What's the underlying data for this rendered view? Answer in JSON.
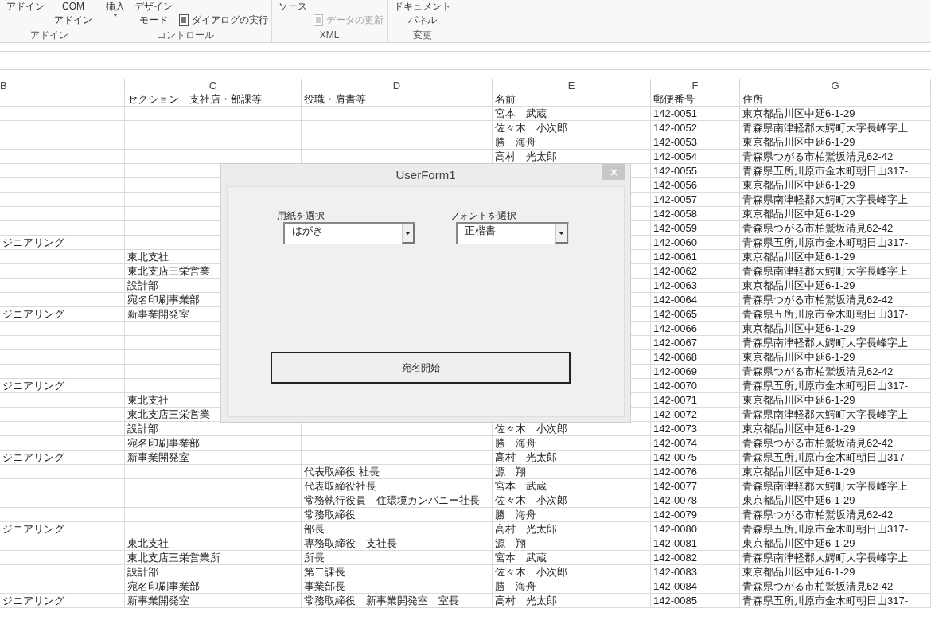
{
  "ribbon": {
    "groups": [
      {
        "label": "アドイン",
        "buttons": [
          {
            "lines": [
              "アドイン"
            ],
            "kind": "large",
            "disabled": false
          },
          {
            "lines": [
              "COM",
              "アドイン"
            ],
            "kind": "large",
            "disabled": false
          }
        ]
      },
      {
        "label": "コントロール",
        "buttons": [
          {
            "label": "挿入",
            "kind": "dropdown",
            "disabled": false
          },
          {
            "lines": [
              "デザイン",
              "モード"
            ],
            "kind": "large",
            "disabled": false
          },
          {
            "label": "ダイアログの実行",
            "kind": "small",
            "disabled": false
          }
        ]
      },
      {
        "label": "XML",
        "buttons": [
          {
            "lines": [
              "ソース"
            ],
            "kind": "large",
            "disabled": false
          },
          {
            "label": "データの更新",
            "kind": "small",
            "disabled": true
          }
        ]
      },
      {
        "label": "変更",
        "buttons": [
          {
            "lines": [
              "ドキュメント",
              "パネル"
            ],
            "kind": "large",
            "disabled": false
          }
        ]
      }
    ]
  },
  "sheet": {
    "columns": [
      "B",
      "C",
      "D",
      "E",
      "F",
      "G"
    ],
    "rows": [
      {
        "c": "セクション　支社店・部課等",
        "d": "役職・肩書等",
        "e": "名前",
        "f": "郵便番号",
        "g": "住所"
      },
      {
        "e": "宮本　武蔵",
        "f": "142-0051",
        "g": "東京都品川区中延6-1-29"
      },
      {
        "e": "佐々木　小次郎",
        "f": "142-0052",
        "g": "青森県南津軽郡大鰐町大字長峰字上"
      },
      {
        "e": "勝　海舟",
        "f": "142-0053",
        "g": "東京都品川区中延6-1-29"
      },
      {
        "e": "高村　光太郎",
        "f": "142-0054",
        "g": "青森県つがる市柏鷲坂清見62-42"
      },
      {
        "f": "142-0055",
        "g": "青森県五所川原市金木町朝日山317-"
      },
      {
        "f": "142-0056",
        "g": "東京都品川区中延6-1-29"
      },
      {
        "f": "142-0057",
        "g": "青森県南津軽郡大鰐町大字長峰字上"
      },
      {
        "f": "142-0058",
        "g": "東京都品川区中延6-1-29"
      },
      {
        "f": "142-0059",
        "g": "青森県つがる市柏鷲坂清見62-42"
      },
      {
        "b": "ジニアリング",
        "f": "142-0060",
        "g": "青森県五所川原市金木町朝日山317-"
      },
      {
        "c": "東北支社",
        "f": "142-0061",
        "g": "東京都品川区中延6-1-29"
      },
      {
        "c": "東北支店三栄営業",
        "f": "142-0062",
        "g": "青森県南津軽郡大鰐町大字長峰字上"
      },
      {
        "c": "設計部",
        "f": "142-0063",
        "g": "東京都品川区中延6-1-29"
      },
      {
        "c": "宛名印刷事業部",
        "f": "142-0064",
        "g": "青森県つがる市柏鷲坂清見62-42"
      },
      {
        "b": "ジニアリング",
        "c": "新事業開発室",
        "f": "142-0065",
        "g": "青森県五所川原市金木町朝日山317-"
      },
      {
        "f": "142-0066",
        "g": "東京都品川区中延6-1-29"
      },
      {
        "f": "142-0067",
        "g": "青森県南津軽郡大鰐町大字長峰字上"
      },
      {
        "f": "142-0068",
        "g": "東京都品川区中延6-1-29"
      },
      {
        "f": "142-0069",
        "g": "青森県つがる市柏鷲坂清見62-42"
      },
      {
        "b": "ジニアリング",
        "f": "142-0070",
        "g": "青森県五所川原市金木町朝日山317-"
      },
      {
        "c": "東北支社",
        "f": "142-0071",
        "g": "東京都品川区中延6-1-29"
      },
      {
        "c": "東北支店三栄営業",
        "f": "142-0072",
        "g": "青森県南津軽郡大鰐町大字長峰字上"
      },
      {
        "c": "設計部",
        "e": "佐々木　小次郎",
        "f": "142-0073",
        "g": "東京都品川区中延6-1-29"
      },
      {
        "c": "宛名印刷事業部",
        "e": "勝　海舟",
        "f": "142-0074",
        "g": "青森県つがる市柏鷲坂清見62-42"
      },
      {
        "b": "ジニアリング",
        "c": "新事業開発室",
        "e": "高村　光太郎",
        "f": "142-0075",
        "g": "青森県五所川原市金木町朝日山317-"
      },
      {
        "d": "代表取締役 社長",
        "e": "源　翔",
        "f": "142-0076",
        "g": "東京都品川区中延6-1-29"
      },
      {
        "d": "代表取締役社長",
        "e": "宮本　武蔵",
        "f": "142-0077",
        "g": "青森県南津軽郡大鰐町大字長峰字上"
      },
      {
        "d": "常務執行役員　住環境カンパニー社長",
        "e": "佐々木　小次郎",
        "f": "142-0078",
        "g": "東京都品川区中延6-1-29"
      },
      {
        "d": "常務取締役",
        "e": "勝　海舟",
        "f": "142-0079",
        "g": "青森県つがる市柏鷲坂清見62-42"
      },
      {
        "b": "ジニアリング",
        "d": "部長",
        "e": "高村　光太郎",
        "f": "142-0080",
        "g": "青森県五所川原市金木町朝日山317-"
      },
      {
        "c": "東北支社",
        "d": "専務取締役　支社長",
        "e": "源　翔",
        "f": "142-0081",
        "g": "東京都品川区中延6-1-29"
      },
      {
        "c": "東北支店三栄営業所",
        "d": "所長",
        "e": "宮本　武蔵",
        "f": "142-0082",
        "g": "青森県南津軽郡大鰐町大字長峰字上"
      },
      {
        "c": "設計部",
        "d": "第二課長",
        "e": "佐々木　小次郎",
        "f": "142-0083",
        "g": "東京都品川区中延6-1-29"
      },
      {
        "c": "宛名印刷事業部",
        "d": "事業部長",
        "e": "勝　海舟",
        "f": "142-0084",
        "g": "青森県つがる市柏鷲坂清見62-42"
      },
      {
        "b": "ジニアリング",
        "c": "新事業開発室",
        "d": "常務取締役　新事業開発室　室長",
        "e": "高村　光太郎",
        "f": "142-0085",
        "g": "青森県五所川原市金木町朝日山317-"
      }
    ]
  },
  "dialog": {
    "title": "UserForm1",
    "combos": [
      {
        "label": "用紙を選択",
        "value": "はがき"
      },
      {
        "label": "フォントを選択",
        "value": "正楷書"
      }
    ],
    "button": "宛名開始"
  }
}
